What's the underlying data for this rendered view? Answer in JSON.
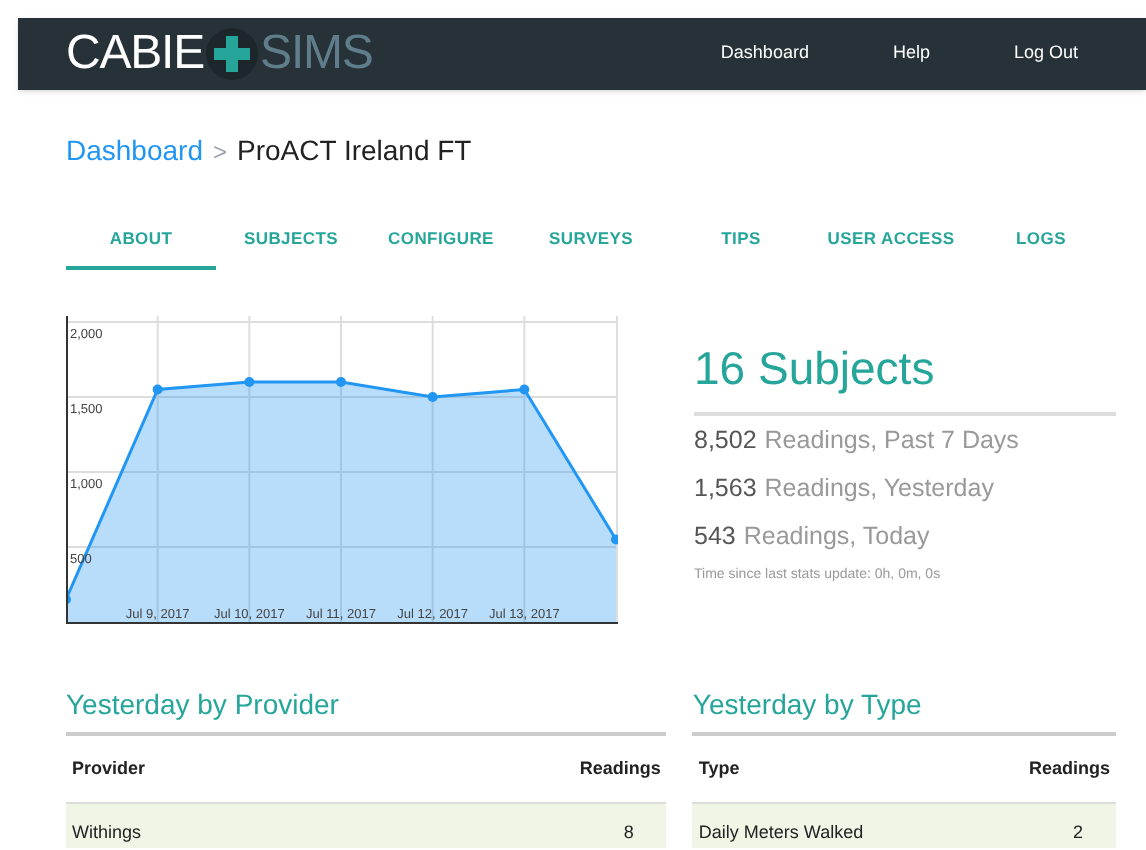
{
  "navbar": {
    "logo_left": "CABIE",
    "logo_right": "SIMS",
    "links": [
      {
        "label": "Dashboard"
      },
      {
        "label": "Help"
      },
      {
        "label": "Log Out"
      }
    ]
  },
  "breadcrumb": {
    "parent": "Dashboard",
    "separator": ">",
    "current": "ProACT Ireland FT"
  },
  "tabs": [
    {
      "label": "ABOUT",
      "selected": true
    },
    {
      "label": "SUBJECTS",
      "selected": false
    },
    {
      "label": "CONFIGURE",
      "selected": false
    },
    {
      "label": "SURVEYS",
      "selected": false
    },
    {
      "label": "TIPS",
      "selected": false
    },
    {
      "label": "USER ACCESS",
      "selected": false
    },
    {
      "label": "LOGS",
      "selected": false
    }
  ],
  "chart_data": {
    "type": "area",
    "categories": [
      null,
      "Jul 9, 2017",
      "Jul 10, 2017",
      "Jul 11, 2017",
      "Jul 12, 2017",
      "Jul 13, 2017",
      null
    ],
    "series": [
      {
        "color": "#2196f3",
        "values": [
          150,
          1550,
          1600,
          1600,
          1500,
          1550,
          550
        ]
      }
    ],
    "ylim": [
      0,
      2000
    ],
    "grid": true,
    "yticks": [
      {
        "value": 500,
        "label": "500"
      },
      {
        "value": 1000,
        "label": "1,000"
      },
      {
        "value": 1500,
        "label": "1,500"
      },
      {
        "value": 2000,
        "label": "2,000"
      }
    ]
  },
  "stats": {
    "title": "16 Subjects",
    "lines": [
      {
        "number": "8,502",
        "label": "Readings, Past 7 Days"
      },
      {
        "number": "1,563",
        "label": "Readings, Yesterday"
      },
      {
        "number": "543",
        "label": "Readings, Today"
      }
    ],
    "updated": "Time since last stats update: 0h, 0m, 0s"
  },
  "tables": [
    {
      "title": "Yesterday by Provider",
      "columns": [
        "Provider",
        "Readings"
      ],
      "rows": [
        [
          "Withings",
          "8"
        ]
      ]
    },
    {
      "title": "Yesterday by Type",
      "columns": [
        "Type",
        "Readings"
      ],
      "rows": [
        [
          "Daily Meters Walked",
          "2"
        ]
      ]
    }
  ]
}
